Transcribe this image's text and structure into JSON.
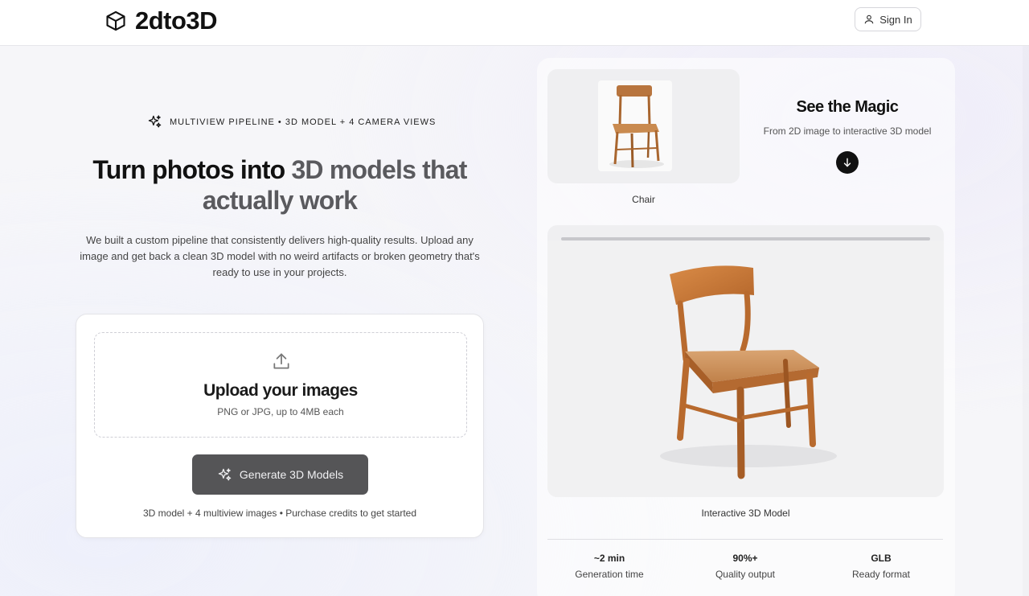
{
  "header": {
    "brand": "2dto3D",
    "signin_label": "Sign In",
    "icons": {
      "logo": "cube-icon",
      "signin": "user-icon"
    }
  },
  "hero": {
    "eyebrow": "MULTIVIEW PIPELINE • 3D MODEL + 4 CAMERA VIEWS",
    "headline_start": "Turn photos into ",
    "headline_muted": "3D models that actually work",
    "lead": "We built a custom pipeline that consistently delivers high-quality results. Upload any image and get back a clean 3D model with no weird artifacts or broken geometry that's ready to use in your projects."
  },
  "upload": {
    "title": "Upload your images",
    "subtitle": "PNG or JPG, up to 4MB each",
    "button_label": "Generate 3D Models",
    "note": "3D model + 4 multiview images • Purchase credits to get started",
    "icons": {
      "upload": "upload-icon",
      "button": "sparkles-icon"
    }
  },
  "demo": {
    "thumb_label": "Chair",
    "title": "See the Magic",
    "subtitle": "From 2D image to interactive 3D model",
    "viewer_label": "Interactive 3D Model",
    "icons": {
      "scroll": "arrow-down-icon"
    }
  },
  "stats": [
    {
      "value": "~2 min",
      "label": "Generation time"
    },
    {
      "value": "90%+",
      "label": "Quality output"
    },
    {
      "value": "GLB",
      "label": "Ready format"
    }
  ],
  "colors": {
    "accent_dark": "#111111",
    "button_bg": "#555557",
    "wood": "#c9783a"
  }
}
